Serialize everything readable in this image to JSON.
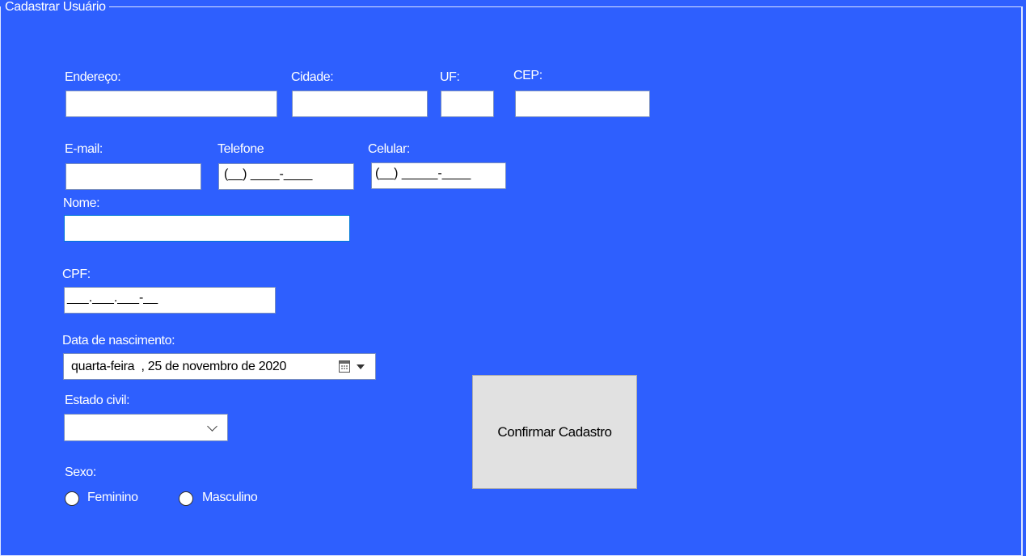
{
  "form": {
    "group_title": "Cadastrar Usuário",
    "labels": {
      "endereco": "Endereço:",
      "cidade": "Cidade:",
      "uf": "UF:",
      "cep": "CEP:",
      "email": "E-mail:",
      "telefone": "Telefone",
      "celular": "Celular:",
      "nome": "Nome:",
      "cpf": "CPF:",
      "data_nascimento": "Data de nascimento:",
      "estado_civil": "Estado civil:",
      "sexo": "Sexo:"
    },
    "fields": {
      "endereco": "",
      "cidade": "",
      "uf": "",
      "cep": "",
      "email": "",
      "telefone_mask": "(__) ____-____",
      "celular_mask": "(__) _____-____",
      "nome": "",
      "cpf_mask": "___.___.___-__",
      "data_nascimento": "quarta-feira  , 25 de novembro de 2020",
      "estado_civil": ""
    },
    "radio_options": [
      "Feminino",
      "Masculino"
    ],
    "submit_label": "Confirmar Cadastro"
  },
  "icons": {
    "date_picker": "calendar-icon",
    "date_dropdown": "dropdown-arrow-icon",
    "combo_dropdown": "chevron-down-icon"
  },
  "colors": {
    "background": "#2e5ffe",
    "button": "#e1e1e1",
    "focus_border": "#0078d7"
  }
}
